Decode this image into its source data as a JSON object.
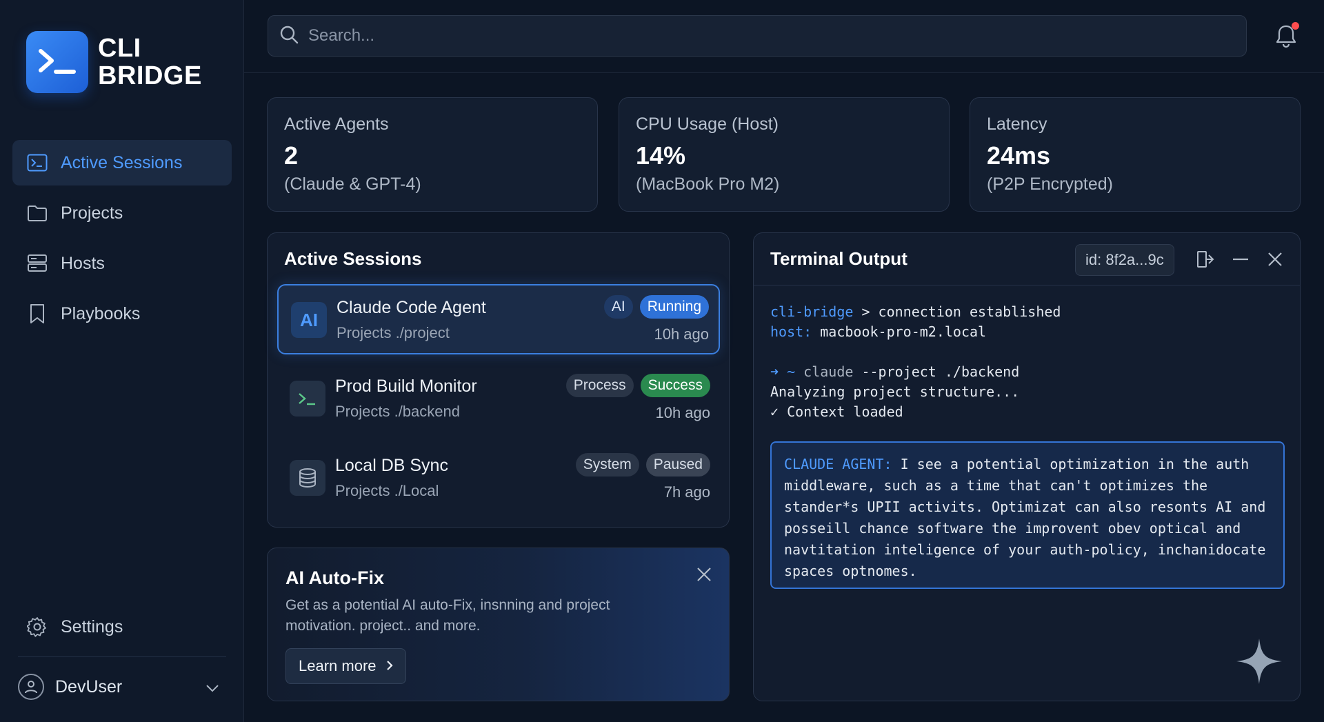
{
  "app": {
    "logo_line1": "CLI",
    "logo_line2": "BRIDGE"
  },
  "sidebar": {
    "items": [
      {
        "label": "Active Sessions",
        "icon": "terminal-icon",
        "active": true
      },
      {
        "label": "Projects",
        "icon": "folder-icon"
      },
      {
        "label": "Hosts",
        "icon": "server-icon"
      },
      {
        "label": "Playbooks",
        "icon": "bookmark-icon"
      }
    ],
    "settings_label": "Settings",
    "user_name": "DevUser"
  },
  "search": {
    "placeholder": "Search..."
  },
  "stats": [
    {
      "label": "Active Agents",
      "value": "2",
      "sub": "(Claude & GPT-4)"
    },
    {
      "label": "CPU Usage (Host)",
      "value": "14%",
      "sub": "(MacBook Pro M2)"
    },
    {
      "label": "Latency",
      "value": "24ms",
      "sub": "(P2P Encrypted)"
    }
  ],
  "sessions": {
    "title": "Active Sessions",
    "items": [
      {
        "icon_text": "AI",
        "name": "Claude Code Agent",
        "path": "Projects ./project",
        "tag": "AI",
        "status": "Running",
        "time": "10h ago"
      },
      {
        "icon_text": ">_",
        "name": "Prod Build Monitor",
        "path": "Projects ./backend",
        "tag": "Process",
        "status": "Success",
        "time": "10h ago"
      },
      {
        "icon_text": "",
        "name": "Local DB Sync",
        "path": "Projects ./Local",
        "tag": "System",
        "status": "Paused",
        "time": "7h ago"
      }
    ]
  },
  "autofix": {
    "title": "AI Auto-Fix",
    "body": "Get as a potential AI auto-Fix, insnning and project motivation. project.. and more.",
    "button_label": "Learn more"
  },
  "terminal": {
    "title": "Terminal Output",
    "session_id": "id: 8f2a...9c",
    "line1_prefix": "cli-bridge",
    "line1_rest": " > connection established",
    "line2_prefix": "host:",
    "line2_rest": " macbook-pro-m2.local",
    "cmd_prompt": "➜ ~",
    "cmd_name": " claude",
    "cmd_args": " --project ./backend",
    "line4": "Analyzing project structure...",
    "line5": "✓ Context loaded",
    "agent_tag": "CLAUDE AGENT:",
    "agent_text": " I see a potential optimization in the auth middleware, such as a time that can't optimizes the stander*s UPII activits. Optimizat can also resonts AI and posseill chance software the improvent obev optical and navtitation inteligence of your auth-policy, inchanidocate spaces optnomes."
  },
  "colors": {
    "accent": "#4f9bff",
    "running": "#2f72d8",
    "success": "#2a8a4f",
    "notification": "#ff4d4f"
  }
}
